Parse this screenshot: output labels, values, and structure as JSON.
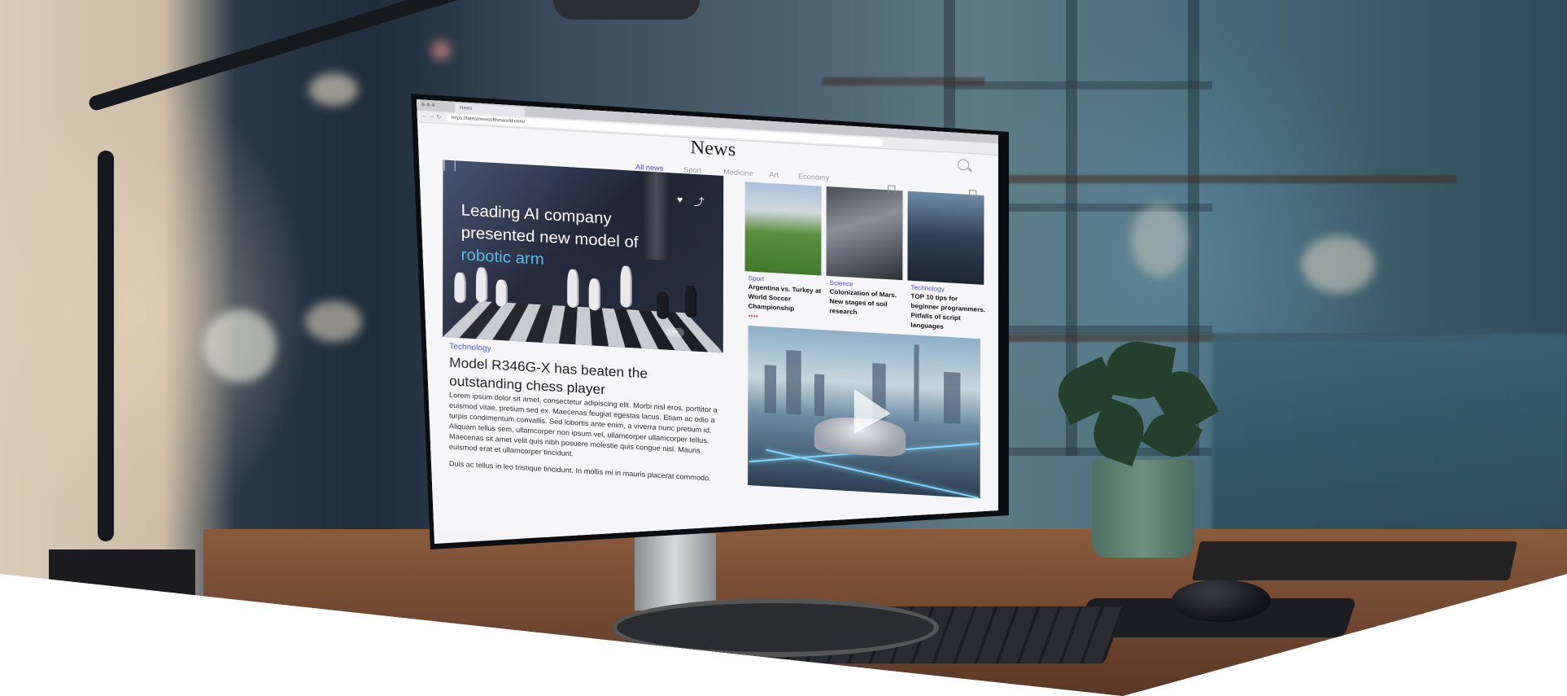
{
  "browser": {
    "tab_label": "News",
    "url": "https://latestnewsoftheworld.com/"
  },
  "site": {
    "title": "News",
    "nav": [
      "All news",
      "Sport",
      "Medicine",
      "Art",
      "Economy"
    ],
    "active_nav": "All news"
  },
  "hero": {
    "headline_line1": "Leading AI company",
    "headline_line2": "presented new model of",
    "headline_highlight": "robotic arm",
    "highlight_color": "#59b8e8"
  },
  "article": {
    "category": "Technology",
    "title": "Model R346G-X has beaten the outstanding chess player",
    "body": "Lorem ipsum dolor sit amet, consectetur adipiscing elit. Morbi nisl eros, porttitor a euismod vitae, pretium sed ex. Maecenas feugiat egestas lacus. Etiam ac odio a turpis condimentum convallis. Sed lobortis ante enim, a viverra nunc pretium id. Aliquam tellus sem, ullamcorper non ipsum vel, ullamcorper ullamcorper tellus. Maecenas sit amet velit quis nibh posuere molestie quis congue nisl. Mauris euismod erat et ullamcorper tincidunt.",
    "body2": "Duis ac tellus in leo tristique tincidunt. In mollis mi in mauris placerat commodo."
  },
  "cards": [
    {
      "category": "Sport",
      "title": "Argentina vs. Turkey at World Soccer Championship"
    },
    {
      "category": "Science",
      "title": "Colonization of Mars. New stages of soil research"
    },
    {
      "category": "Technology",
      "title": "TOP 10 tips for beginner programmers. Pitfalls of script languages"
    }
  ],
  "colors": {
    "accent": "#4b4ce0",
    "desk": "#7a4c34"
  },
  "icons": [
    "search-icon",
    "bookmark-icon",
    "heart-icon",
    "share-icon",
    "play-icon"
  ]
}
